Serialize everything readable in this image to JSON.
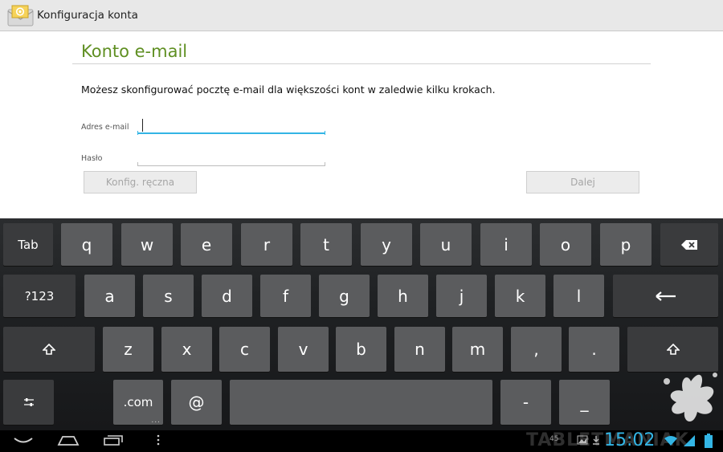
{
  "action_bar": {
    "title": "Konfiguracja konta",
    "icon": "email-app-icon"
  },
  "page": {
    "title": "Konto e-mail",
    "intro": "Możesz skonfigurować pocztę e-mail dla większości kont w zaledwie kilku krokach.",
    "email_label": "Adres e-mail",
    "email_value": "",
    "password_label": "Hasło",
    "password_value": "",
    "manual_button": "Konfig. ręczna",
    "next_button": "Dalej"
  },
  "keyboard": {
    "tab": "Tab",
    "row1": [
      "q",
      "w",
      "e",
      "r",
      "t",
      "y",
      "u",
      "i",
      "o",
      "p"
    ],
    "symbols": "?123",
    "row2": [
      "a",
      "s",
      "d",
      "f",
      "g",
      "h",
      "j",
      "k",
      "l"
    ],
    "row3": [
      "z",
      "x",
      "c",
      "v",
      "b",
      "n",
      "m",
      ",",
      "."
    ],
    "dotcom": ".com",
    "at": "@",
    "dash": "-",
    "underscore": "_",
    "dotcom_more": "..."
  },
  "status_bar": {
    "notification_count": "45",
    "time": "15:02",
    "watermark": "TABLETMANIAK"
  },
  "colors": {
    "accent": "#33b5e5",
    "title_green": "#5f8f22",
    "key": "#5b5c5e",
    "function_key": "#3a3b3d"
  }
}
